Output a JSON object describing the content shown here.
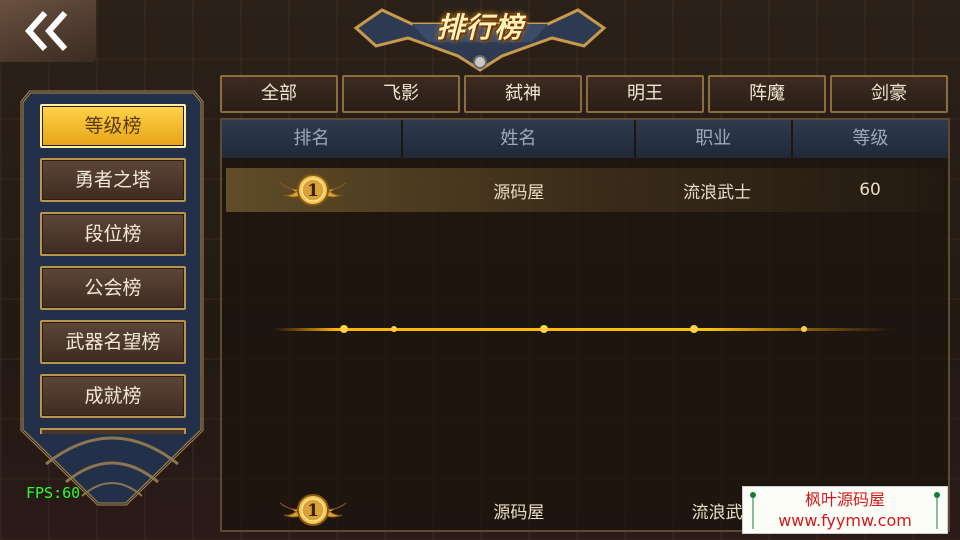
{
  "header": {
    "back_icon": "double-chevron-left-icon",
    "title": "排行榜"
  },
  "sidebar": {
    "items": [
      {
        "label": "等级榜",
        "active": true
      },
      {
        "label": "勇者之塔",
        "active": false
      },
      {
        "label": "段位榜",
        "active": false
      },
      {
        "label": "公会榜",
        "active": false
      },
      {
        "label": "武器名望榜",
        "active": false
      },
      {
        "label": "成就榜",
        "active": false
      }
    ]
  },
  "tabs": [
    "全部",
    "飞影",
    "弑神",
    "明王",
    "阵魔",
    "剑豪"
  ],
  "table": {
    "columns": [
      "排名",
      "姓名",
      "职业",
      "等级"
    ],
    "rows": [
      {
        "rank": "1",
        "name": "源码屋",
        "job": "流浪武士",
        "level": "60"
      }
    ],
    "self_row": {
      "rank": "1",
      "name": "源码屋",
      "job": "流浪武"
    }
  },
  "fps": "FPS:60",
  "watermark": {
    "title": "枫叶源码屋",
    "url": "www.fyymw.com"
  },
  "colors": {
    "active_tab": "#ffd34a",
    "border_gold": "#b9954a",
    "fps_green": "#2aff2a",
    "watermark_red": "#d11a1a"
  }
}
